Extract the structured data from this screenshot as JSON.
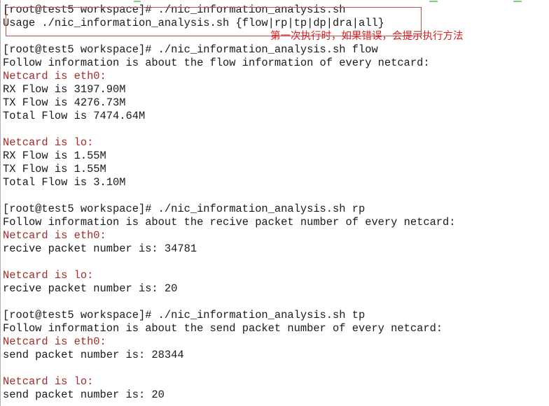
{
  "terminal": {
    "prompt": "[root@test5 workspace]# ",
    "lines": [
      {
        "text": "[root@test5 workspace]# ./nic_information_analysis.sh",
        "kind": "command"
      },
      {
        "text": "Usage ./nic_information_analysis.sh {flow|rp|tp|dp|dra|all}",
        "kind": "output"
      },
      {
        "text": "",
        "kind": "blank"
      },
      {
        "text": "[root@test5 workspace]# ./nic_information_analysis.sh flow",
        "kind": "command"
      },
      {
        "text": "Follow information is about the flow information of every netcard:",
        "kind": "output"
      },
      {
        "text": "Netcard is eth0:",
        "kind": "header"
      },
      {
        "text": "RX Flow is 3197.90M",
        "kind": "output"
      },
      {
        "text": "TX Flow is 4276.73M",
        "kind": "output"
      },
      {
        "text": "Total Flow is 7474.64M",
        "kind": "output"
      },
      {
        "text": "",
        "kind": "blank"
      },
      {
        "text": "Netcard is lo:",
        "kind": "header"
      },
      {
        "text": "RX Flow is 1.55M",
        "kind": "output"
      },
      {
        "text": "TX Flow is 1.55M",
        "kind": "output"
      },
      {
        "text": "Total Flow is 3.10M",
        "kind": "output"
      },
      {
        "text": "",
        "kind": "blank"
      },
      {
        "text": "[root@test5 workspace]# ./nic_information_analysis.sh rp",
        "kind": "command"
      },
      {
        "text": "Follow information is about the recive packet number of every netcard:",
        "kind": "output"
      },
      {
        "text": "Netcard is eth0:",
        "kind": "header"
      },
      {
        "text": "recive packet number is: 34781",
        "kind": "output"
      },
      {
        "text": "",
        "kind": "blank"
      },
      {
        "text": "Netcard is lo:",
        "kind": "header"
      },
      {
        "text": "recive packet number is: 20",
        "kind": "output"
      },
      {
        "text": "",
        "kind": "blank"
      },
      {
        "text": "[root@test5 workspace]# ./nic_information_analysis.sh tp",
        "kind": "command"
      },
      {
        "text": "Follow information is about the send packet number of every netcard:",
        "kind": "output"
      },
      {
        "text": "Netcard is eth0:",
        "kind": "header"
      },
      {
        "text": "send packet number is: 28344",
        "kind": "output"
      },
      {
        "text": "",
        "kind": "blank"
      },
      {
        "text": "Netcard is lo:",
        "kind": "header"
      },
      {
        "text": "send packet number is: 20",
        "kind": "output"
      }
    ]
  },
  "annotation": {
    "text": "第一次执行时，如果错误，会提示执行方法",
    "color": "#d42020"
  },
  "colors": {
    "header_text": "#a52a2a",
    "normal_text": "#1a1a1a",
    "annotation_box": "#c0504d",
    "top_mark": "#7fd07f"
  }
}
